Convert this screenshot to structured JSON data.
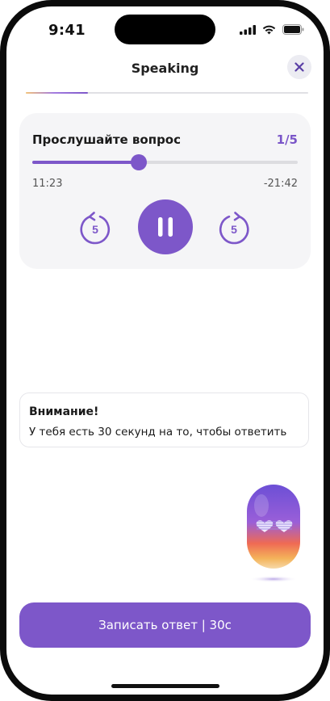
{
  "status_bar": {
    "time": "9:41"
  },
  "header": {
    "title": "Speaking",
    "progress": 0.22
  },
  "player": {
    "title": "Прослушайте вопрос",
    "counter": "1/5",
    "elapsed": "11:23",
    "remaining": "-21:42",
    "position": 0.4,
    "skip_back_label": "5",
    "skip_forward_label": "5"
  },
  "notice": {
    "title": "Внимание!",
    "text": "У тебя есть 30 секунд на то, чтобы ответить"
  },
  "record_button": {
    "label": "Записать ответ | 30с"
  },
  "colors": {
    "accent": "#7d57c9",
    "card_bg": "#f5f5f7"
  }
}
